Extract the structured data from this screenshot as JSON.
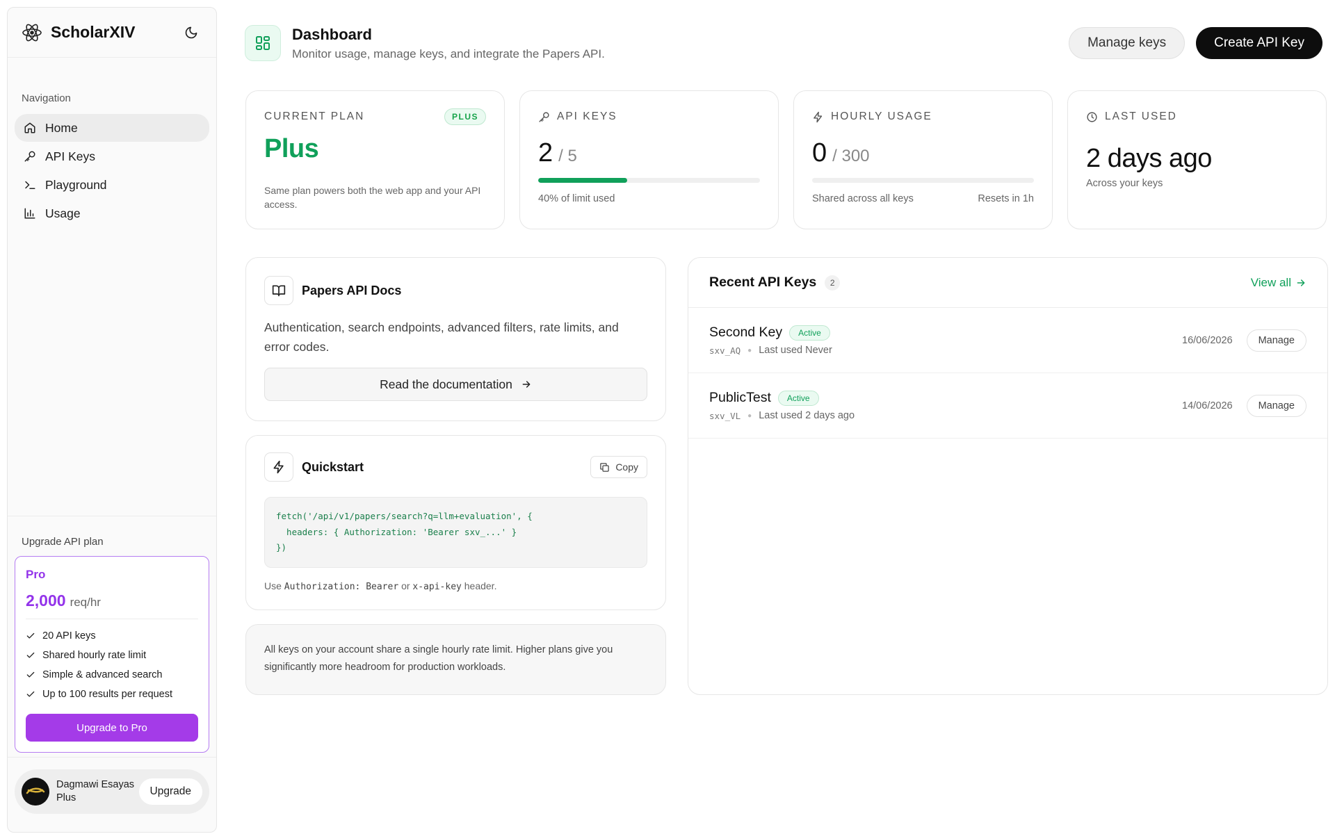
{
  "app": {
    "name": "ScholarXIV"
  },
  "sidebar": {
    "nav_heading": "Navigation",
    "items": [
      {
        "label": "Home",
        "icon": "home-icon",
        "active": true
      },
      {
        "label": "API Keys",
        "icon": "key-icon",
        "active": false
      },
      {
        "label": "Playground",
        "icon": "terminal-icon",
        "active": false
      },
      {
        "label": "Usage",
        "icon": "bar-chart-icon",
        "active": false
      }
    ],
    "upgrade_heading": "Upgrade API plan",
    "plan": {
      "name": "Pro",
      "rate_value": "2,000",
      "rate_unit": "req/hr",
      "features": [
        "20 API keys",
        "Shared hourly rate limit",
        "Simple & advanced search",
        "Up to 100 results per request"
      ],
      "button": "Upgrade to Pro"
    },
    "user": {
      "name": "Dagmawi Esayas",
      "plan": "Plus",
      "upgrade_label": "Upgrade"
    }
  },
  "header": {
    "title": "Dashboard",
    "subtitle": "Monitor usage, manage keys, and integrate the Papers API.",
    "manage_keys": "Manage keys",
    "create_key": "Create API Key"
  },
  "stats": {
    "plan": {
      "label": "CURRENT PLAN",
      "badge": "PLUS",
      "value": "Plus",
      "desc": "Same plan powers both the web app and your API access."
    },
    "keys": {
      "label": "API KEYS",
      "value": "2",
      "limit": "/ 5",
      "progress": 0.4,
      "foot": "40% of limit used"
    },
    "hourly": {
      "label": "HOURLY USAGE",
      "value": "0",
      "limit": "/ 300",
      "progress": 0,
      "foot_left": "Shared across all keys",
      "foot_right": "Resets in 1h"
    },
    "last": {
      "label": "LAST USED",
      "value": "2 days ago",
      "foot": "Across your keys"
    }
  },
  "docs": {
    "title": "Papers API Docs",
    "desc": "Authentication, search endpoints, advanced filters, rate limits, and error codes.",
    "button": "Read the documentation"
  },
  "quickstart": {
    "title": "Quickstart",
    "copy": "Copy",
    "code": "fetch('/api/v1/papers/search?q=llm+evaluation', {\n  headers: { Authorization: 'Bearer sxv_...' }\n})",
    "note_prefix": "Use",
    "note_code1": "Authorization: Bearer",
    "note_mid": "or",
    "note_code2": "x-api-key",
    "note_suffix": "header."
  },
  "note": {
    "text": "All keys on your account share a single hourly rate limit. Higher plans give you significantly more headroom for production workloads."
  },
  "recent": {
    "title": "Recent API Keys",
    "count": "2",
    "view_all": "View all",
    "keys": [
      {
        "name": "Second Key",
        "status": "Active",
        "prefix": "sxv_AQ",
        "last_used": "Last used Never",
        "date": "16/06/2026",
        "manage": "Manage"
      },
      {
        "name": "PublicTest",
        "status": "Active",
        "prefix": "sxv_VL",
        "last_used": "Last used 2 days ago",
        "date": "14/06/2026",
        "manage": "Manage"
      }
    ]
  },
  "colors": {
    "accent_green": "#10a05a",
    "accent_purple": "#9333ea",
    "primary_button": "#0d0d0d"
  }
}
